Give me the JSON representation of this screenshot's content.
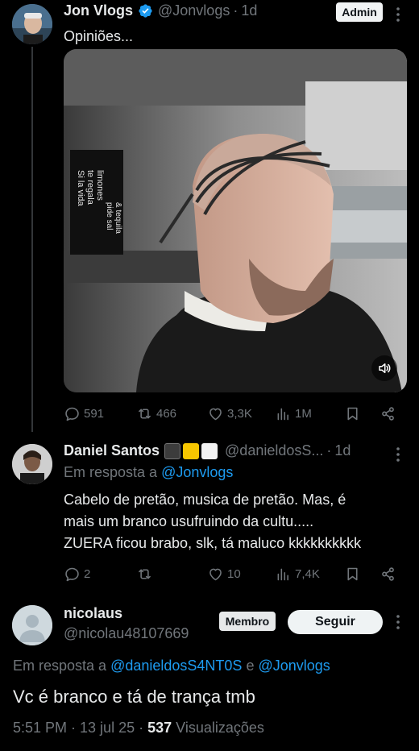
{
  "tweet": {
    "author": "Jon Vlogs",
    "handle": "@Jonvlogs",
    "separator": "·",
    "time": "1d",
    "role_badge": "Admin",
    "text": "Opiniões...",
    "media_overlay": {
      "sign_line1": "Si la vida",
      "sign_line2": "te regala",
      "sign_line3": "limones",
      "sign_line4": "pide sal",
      "sign_line5": "& tequila"
    },
    "stats": {
      "replies": "591",
      "retweets": "466",
      "likes": "3,3K",
      "views": "1M"
    }
  },
  "reply": {
    "author": "Daniel Santos",
    "handle": "@danieldosS...",
    "separator": "·",
    "time": "1d",
    "reply_prefix": "Em resposta a",
    "reply_to": "@Jonvlogs",
    "line1": "Cabelo de pretão, musica de pretão. Mas, é",
    "line2": "mais um branco usufruindo da cultu.....",
    "line3": "ZUERA ficou brabo, slk, tá maluco kkkkkkkkkk",
    "stats": {
      "replies": "2",
      "retweets": "",
      "likes": "10",
      "views": "7,4K"
    },
    "emoji_colors": [
      "#3c3c3c",
      "#f7c600",
      "#f2f2f2"
    ]
  },
  "focused": {
    "author": "nicolaus",
    "handle": "@nicolau48107669",
    "role_badge": "Membro",
    "follow_label": "Seguir",
    "reply_prefix": "Em resposta a",
    "reply_to_1": "@danieldosS4NT0S",
    "conjunction": "e",
    "reply_to_2": "@Jonvlogs",
    "text": "Vc é branco e tá de trança tmb",
    "timestamp": "5:51 PM · 13 jul 25 ·",
    "views_count": "537",
    "views_label": "Visualizações"
  },
  "colors": {
    "accent": "#1d9bf0",
    "muted": "#71767b",
    "background": "#000000"
  }
}
